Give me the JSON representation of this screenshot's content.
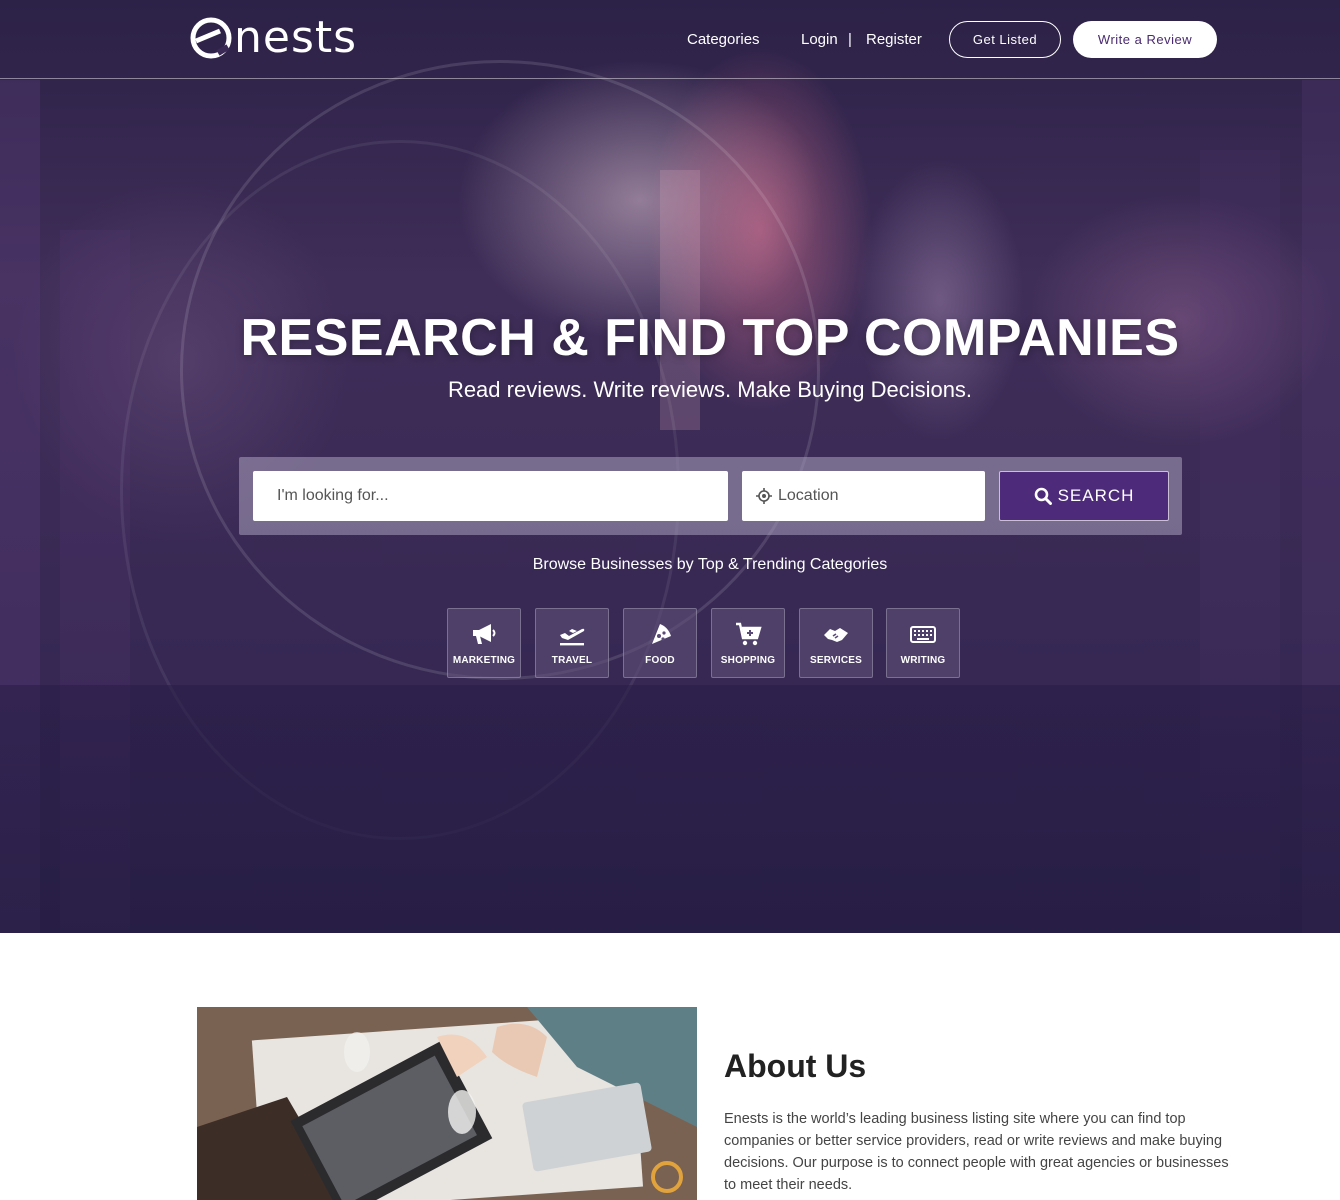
{
  "brand": {
    "logo_text": "nests"
  },
  "nav": {
    "categories": "Categories",
    "login": "Login",
    "separator": "|",
    "register": "Register",
    "get_listed": "Get Listed",
    "write_review": "Write a Review"
  },
  "hero": {
    "title": "RESEARCH & FIND TOP COMPANIES",
    "subtitle": "Read reviews. Write reviews. Make Buying Decisions."
  },
  "search": {
    "looking_for_placeholder": "I'm looking for...",
    "location_placeholder": "Location",
    "button_label": "SEARCH"
  },
  "browse": {
    "title": "Browse Businesses by Top & Trending Categories",
    "categories": [
      {
        "label": "MARKETING",
        "icon": "megaphone-icon"
      },
      {
        "label": "TRAVEL",
        "icon": "plane-icon"
      },
      {
        "label": "FOOD",
        "icon": "pizza-icon"
      },
      {
        "label": "SHOPPING",
        "icon": "cart-icon"
      },
      {
        "label": "SERVICES",
        "icon": "handshake-icon"
      },
      {
        "label": "WRITING",
        "icon": "keyboard-icon"
      }
    ]
  },
  "about": {
    "title": "About Us",
    "text": "Enests is the world’s leading business listing site where you can find top companies or better service providers, read or write reviews and make buying decisions. Our purpose is to connect people with great agencies or businesses to meet their needs."
  },
  "colors": {
    "accent": "#4e2a7a",
    "hero_overlay": "#3a2a55"
  }
}
